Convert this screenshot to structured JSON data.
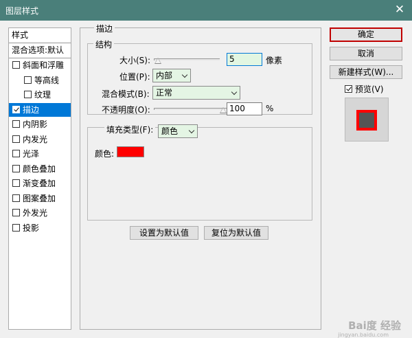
{
  "window": {
    "title": "图层样式",
    "close_glyph": "✕"
  },
  "sidebar": {
    "header": "样式",
    "blend_default": "混合选项:默认",
    "items": [
      {
        "label": "斜面和浮雕",
        "checked": false,
        "indent": 0,
        "selected": false
      },
      {
        "label": "等高线",
        "checked": false,
        "indent": 1,
        "selected": false
      },
      {
        "label": "纹理",
        "checked": false,
        "indent": 1,
        "selected": false
      },
      {
        "label": "描边",
        "checked": true,
        "indent": 0,
        "selected": true
      },
      {
        "label": "内阴影",
        "checked": false,
        "indent": 0,
        "selected": false
      },
      {
        "label": "内发光",
        "checked": false,
        "indent": 0,
        "selected": false
      },
      {
        "label": "光泽",
        "checked": false,
        "indent": 0,
        "selected": false
      },
      {
        "label": "颜色叠加",
        "checked": false,
        "indent": 0,
        "selected": false
      },
      {
        "label": "渐变叠加",
        "checked": false,
        "indent": 0,
        "selected": false
      },
      {
        "label": "图案叠加",
        "checked": false,
        "indent": 0,
        "selected": false
      },
      {
        "label": "外发光",
        "checked": false,
        "indent": 0,
        "selected": false
      },
      {
        "label": "投影",
        "checked": false,
        "indent": 0,
        "selected": false
      }
    ]
  },
  "stroke": {
    "section_title": "描边",
    "structure_title": "结构",
    "size_label": "大小(S):",
    "size_value": "5",
    "size_unit": "像素",
    "size_level": 0.05,
    "position_label": "位置(P):",
    "position_value": "内部",
    "blend_label": "混合模式(B):",
    "blend_value": "正常",
    "opacity_label": "不透明度(O):",
    "opacity_value": "100",
    "opacity_unit": "%",
    "opacity_level": 1.0,
    "fill_type_label": "填充类型(F):",
    "fill_type_value": "颜色",
    "color_label": "颜色:",
    "color_hex": "#ff0000",
    "set_default_button": "设置为默认值",
    "reset_default_button": "复位为默认值"
  },
  "actions": {
    "ok_button": "确定",
    "cancel_button": "取消",
    "new_style_button": "新建样式(W)...",
    "preview_label": "预览(V)",
    "preview_checked": true
  },
  "watermark": {
    "text": "Bai度 经验",
    "sub": "jingyan.baidu.com"
  },
  "colors": {
    "titlebar": "#4a7f7a",
    "selection": "#0078d7",
    "stroke": "#ff0000",
    "ok_border": "#c00000"
  }
}
